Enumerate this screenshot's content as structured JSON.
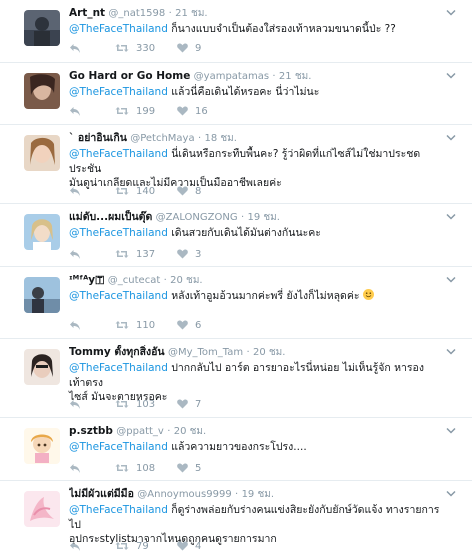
{
  "tweets": [
    {
      "name": "Art_nt",
      "handle": "@_nat1598",
      "time": "21 ชม.",
      "mention": "@TheFaceThailand",
      "text": " ก็นางแบบจำเป็นต้องใส่รองเท้าหลวมขนาดนี้ป่ะ ??",
      "text2": "",
      "retweets": "330",
      "likes": "9",
      "avatar_color": "#4a5566"
    },
    {
      "name": "Go Hard or Go Home",
      "handle": "@yampatamas",
      "time": "21 ชม.",
      "mention": "@TheFaceThailand",
      "text": " แล้วนี่คือเดินได้หรอคะ นี่ว่าไม่นะ",
      "text2": "",
      "retweets": "199",
      "likes": "16",
      "avatar_color": "#6b4a3a"
    },
    {
      "name": "` อย่าอินเกิน",
      "handle": "@PetchMaya",
      "time": "18 ชม.",
      "mention": "@TheFaceThailand",
      "text": " นี่เดินหรือกระทืบพื้นคะ? รู้ว่าผิดที่แก่ไซส์ไม่ใช่มาประชดประชัน",
      "text2": "มันดูน่าเกลียดและไม่มีความเป็นมืออาชีพเลยค่ะ",
      "retweets": "140",
      "likes": "8",
      "avatar_color": "#c9a27e"
    },
    {
      "name": "แม่ดับ...ผมเป็นตุ๊ด",
      "handle": "@ZALONGZONG",
      "time": "19 ชม.",
      "mention": "@TheFaceThailand",
      "text": " เดินสวยกับเดินได้มันต่างกันนะคะ",
      "text2": "",
      "retweets": "137",
      "likes": "3",
      "avatar_color": "#8fb7d6"
    },
    {
      "name": "ᶦᴹᶠᴬy🇹",
      "handle": "@_cutecat",
      "time": "20 ชม.",
      "mention": "@TheFaceThailand",
      "text": " หลังเท้าอูมอ้วนมากค่ะพรี่ ยังไงก็ไม่หลุดค่ะ",
      "text2": "",
      "retweets": "110",
      "likes": "6",
      "avatar_color": "#7fa6c8"
    },
    {
      "name": "Tommy ตั้งทุกสิ่งอัน",
      "handle": "@My_Tom_Tam",
      "time": "20 ชม.",
      "mention": "@TheFaceThailand",
      "text": " ปากกลับไป อาร์ต อารยาอะไรนี่หน่อย ไม่เห็นรู้จัก หารองเท้าตรง",
      "text2": "ไซส์ มันจะตายหรอคะ",
      "retweets": "103",
      "likes": "7",
      "avatar_color": "#d9c3b5"
    },
    {
      "name": "p.sztbb",
      "handle": "@ppatt_v",
      "time": "20 ชม.",
      "mention": "@TheFaceThailand",
      "text": " แล้วความยาวของกระโปรง....",
      "text2": "",
      "retweets": "108",
      "likes": "5",
      "avatar_color": "#f2e3c4"
    },
    {
      "name": "ไม่มีผัวแต่มีมือ",
      "handle": "@Annoymous9999",
      "time": "19 ชม.",
      "mention": "@TheFaceThailand",
      "text": " ก็ดูร่างพล่อยกับร่างคนแข่งสิยะยังกับยักษ์วัดแจ้ง ทางรายการไป",
      "text2": "อุปกระstylistมาจากไหนดูถูกคนดูรายการมาก",
      "retweets": "79",
      "likes": "4",
      "avatar_color": "#f0c4d4"
    }
  ],
  "colors": {
    "accent": "#1b95e0",
    "meta": "#8899a6",
    "icon": "#aab8c2"
  }
}
